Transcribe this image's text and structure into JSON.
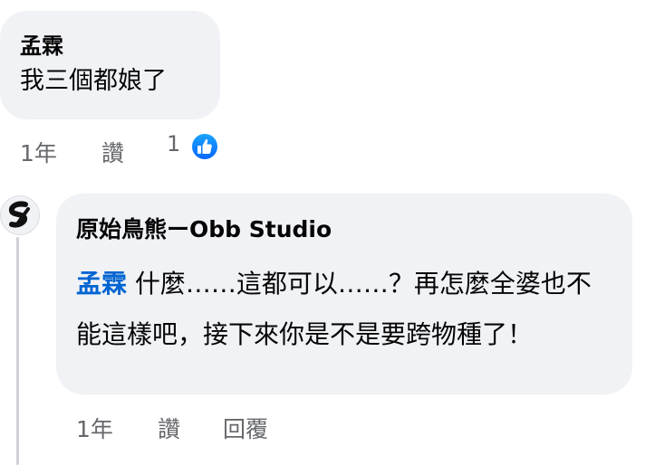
{
  "comment1": {
    "author": "孟霖",
    "text": "我三個都娘了",
    "time": "1年",
    "like_label": "讚",
    "reaction_count": "1",
    "reaction_icon": "thumbs-up-icon",
    "reaction_color": "#0866ff"
  },
  "reply1": {
    "avatar_icon": "obb-studio-logo",
    "author": "原始鳥熊ーObb Studio",
    "mention": "孟霖",
    "text": " 什麼……這都可以……？再怎麼全婆也不能這樣吧，接下來你是不是要跨物種了！",
    "time": "1年",
    "like_label": "讚",
    "reply_label": "回覆"
  }
}
